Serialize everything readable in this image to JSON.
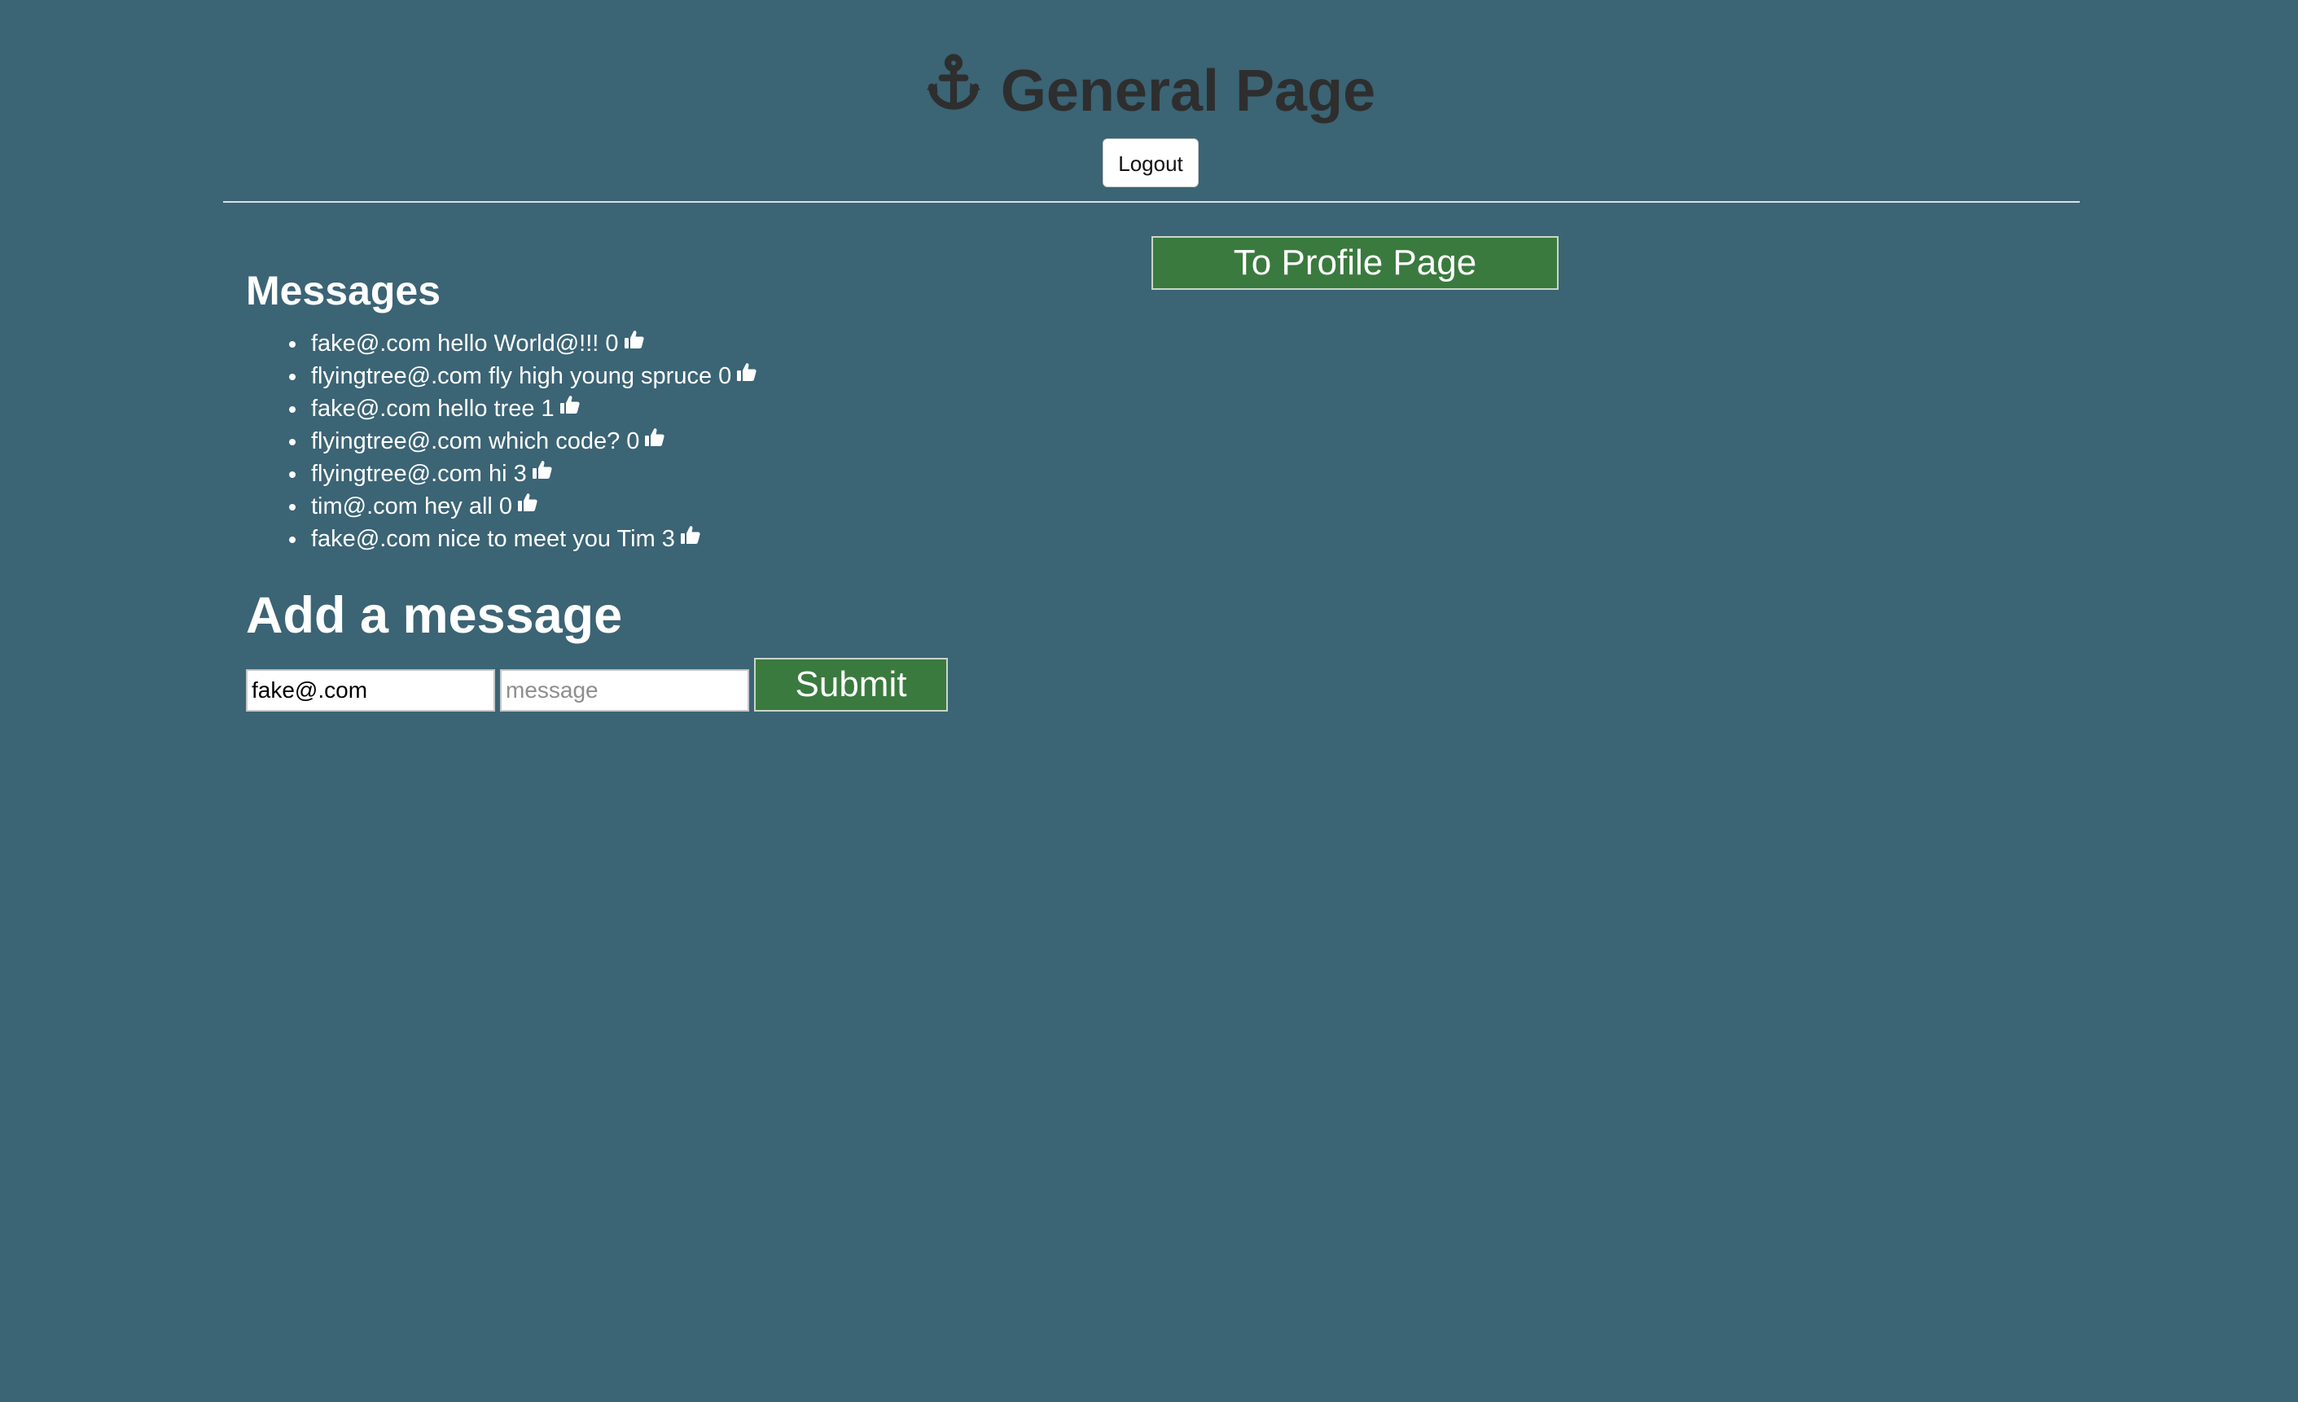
{
  "header": {
    "title": "General Page",
    "logout_label": "Logout"
  },
  "nav": {
    "profile_label": "To Profile Page"
  },
  "messages": {
    "heading": "Messages",
    "items": [
      {
        "email": "fake@.com",
        "text": "hello World@!!!",
        "likes": "0"
      },
      {
        "email": "flyingtree@.com",
        "text": "fly high young spruce",
        "likes": "0"
      },
      {
        "email": "fake@.com",
        "text": "hello tree",
        "likes": "1"
      },
      {
        "email": "flyingtree@.com",
        "text": "which code?",
        "likes": "0"
      },
      {
        "email": "flyingtree@.com",
        "text": "hi",
        "likes": "3"
      },
      {
        "email": "tim@.com",
        "text": "hey all",
        "likes": "0"
      },
      {
        "email": "fake@.com",
        "text": "nice to meet you Tim",
        "likes": "3"
      }
    ]
  },
  "form": {
    "heading": "Add a message",
    "email_value": "fake@.com",
    "message_placeholder": "message",
    "submit_label": "Submit"
  },
  "icons": {
    "title_icon": "anchor-icon",
    "like_icon": "thumbs-up-icon"
  },
  "colors": {
    "background": "#3b6475",
    "title": "#2e2e2e",
    "button_green": "#3a7a3e"
  }
}
